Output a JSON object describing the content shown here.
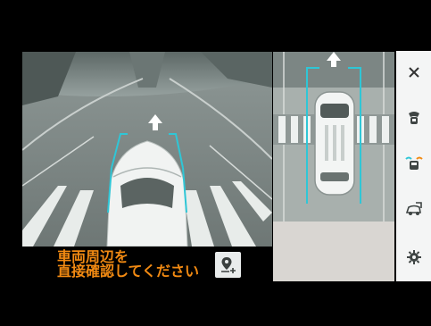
{
  "warning": {
    "line1": "車両周辺を",
    "line2": "直接確認してください",
    "color": "#f28a12"
  },
  "icons": {
    "close": "close-icon",
    "front_camera": "front-camera-view-icon",
    "wide_view": "wide-view-icon",
    "side_view": "side-view-icon",
    "settings": "gear-icon",
    "location_add": "location-pin-add-icon"
  },
  "colors": {
    "guide_line": "#2fc6d6",
    "panel_bg": "#f4f5f5",
    "accent_orange": "#f28a12"
  }
}
